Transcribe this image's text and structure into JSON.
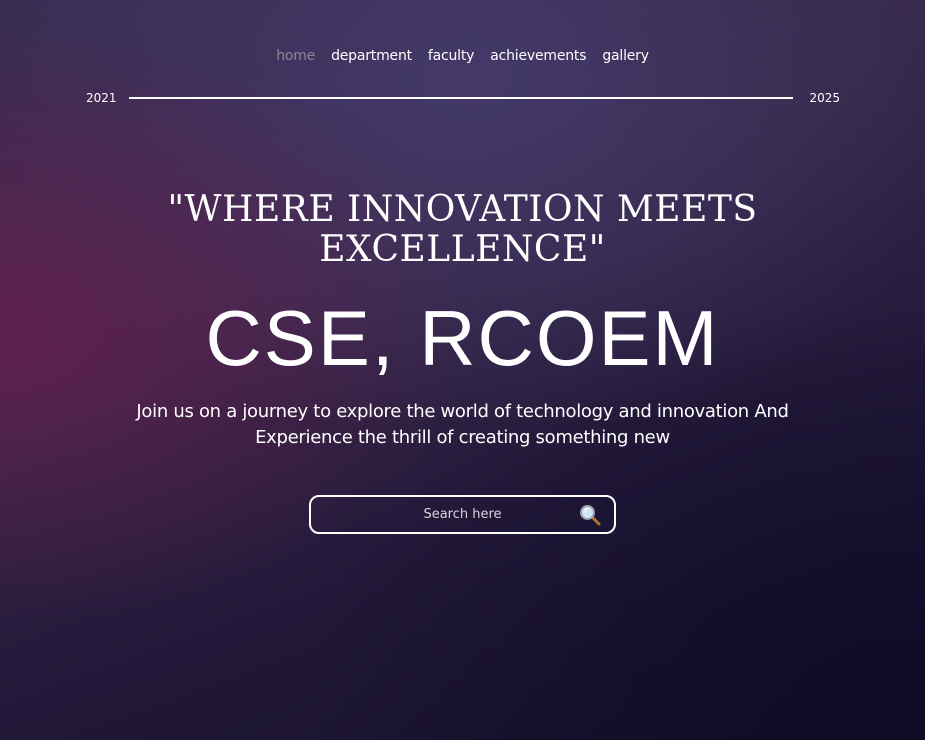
{
  "nav": {
    "items": [
      {
        "label": "home",
        "active": true
      },
      {
        "label": "department",
        "active": false
      },
      {
        "label": "faculty",
        "active": false
      },
      {
        "label": "achievements",
        "active": false
      },
      {
        "label": "gallery",
        "active": false
      }
    ]
  },
  "timeline": {
    "start_year": "2021",
    "end_year": "2025"
  },
  "hero": {
    "quote": "\"Where Innovation Meets Excellence\"",
    "title": "CSE, RCOEM",
    "tagline": "Join us on a journey to explore the world of technology and innovation And Experience the thrill of creating something new"
  },
  "search": {
    "value": "",
    "placeholder": "Search here",
    "icon": "search-icon"
  },
  "colors": {
    "text": "#ffffff",
    "nav_active": "#8d8894",
    "bg_dark": "#140f2a",
    "bg_mid": "#352848",
    "bg_accent": "#6e1e50"
  }
}
